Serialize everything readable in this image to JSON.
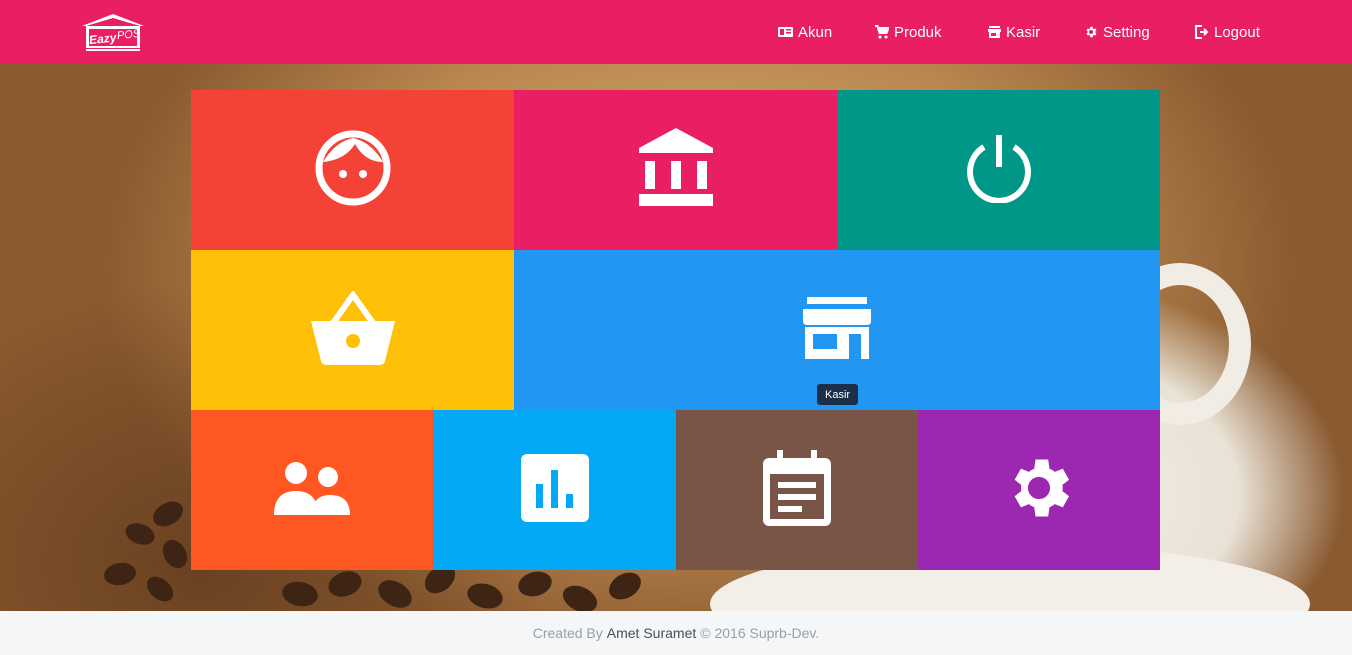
{
  "app": {
    "logo_text": "EazyPOS"
  },
  "nav": {
    "items": [
      {
        "label": "Akun",
        "icon": "id-card-icon"
      },
      {
        "label": "Produk",
        "icon": "cart-icon"
      },
      {
        "label": "Kasir",
        "icon": "store-icon"
      },
      {
        "label": "Setting",
        "icon": "gear-icon"
      },
      {
        "label": "Logout",
        "icon": "logout-icon"
      }
    ]
  },
  "tiles": [
    {
      "name": "face",
      "color": "#f44336",
      "icon": "face-icon"
    },
    {
      "name": "bank",
      "color": "#e91e63",
      "icon": "bank-icon"
    },
    {
      "name": "power",
      "color": "#009688",
      "icon": "power-icon"
    },
    {
      "name": "basket",
      "color": "#ffc107",
      "icon": "basket-icon"
    },
    {
      "name": "store",
      "color": "#2196f3",
      "icon": "store-icon"
    },
    {
      "name": "people",
      "color": "#ff5722",
      "icon": "people-icon"
    },
    {
      "name": "chart",
      "color": "#03a9f4",
      "icon": "bar-chart-icon"
    },
    {
      "name": "calendar",
      "color": "#795548",
      "icon": "calendar-icon"
    },
    {
      "name": "settings",
      "color": "#9c27b0",
      "icon": "gear-icon"
    }
  ],
  "tooltip": {
    "text": "Kasir"
  },
  "footer": {
    "prefix": "Created By",
    "author": "Amet Suramet",
    "suffix": "© 2016 Suprb-Dev."
  }
}
